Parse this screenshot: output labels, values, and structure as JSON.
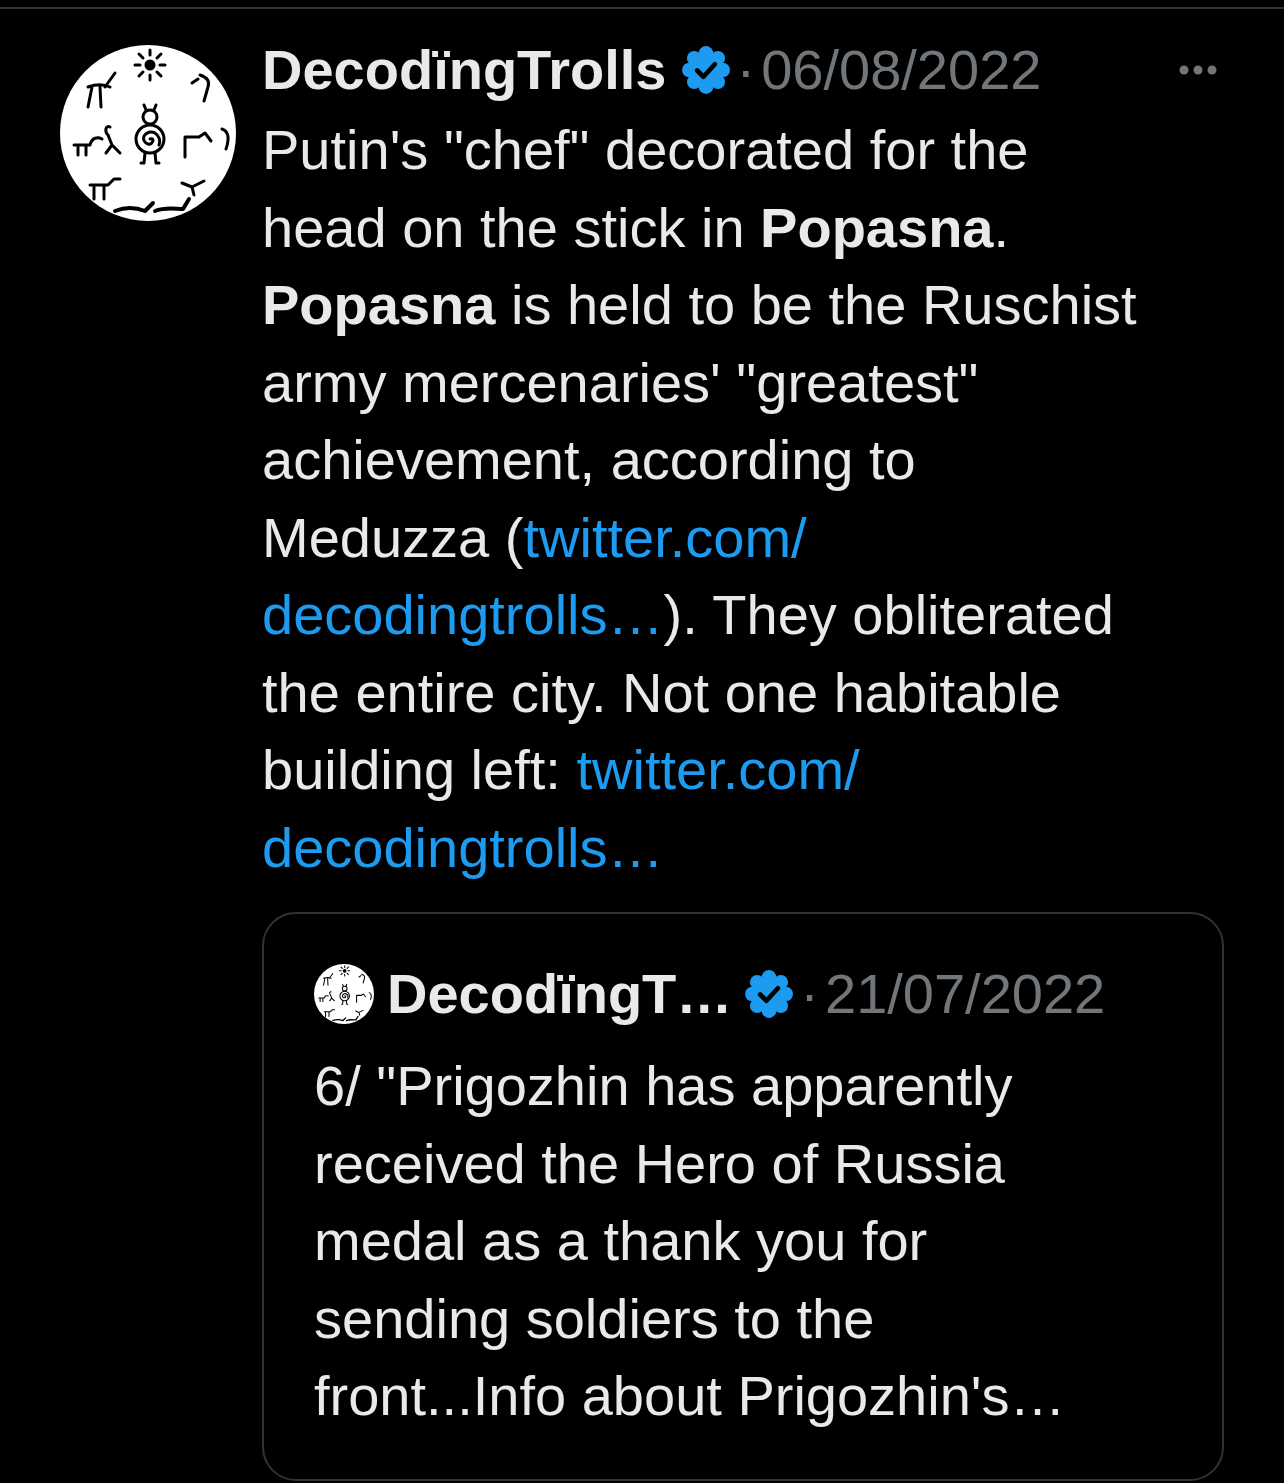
{
  "tweet": {
    "author": {
      "name": "DecodïngTrolls",
      "verified": true
    },
    "separator": "·",
    "date": "06/08/2022",
    "text": [
      {
        "kind": "text",
        "text": "Putin's \"chef\" decorated for the head on the stick in "
      },
      {
        "kind": "bold",
        "text": "Popasna"
      },
      {
        "kind": "text",
        "text": ". "
      },
      {
        "kind": "bold",
        "text": "Popasna"
      },
      {
        "kind": "text",
        "text": " is held to be the Ruschist army mercenaries' \"greatest\" achievement, according to Meduzza ("
      },
      {
        "kind": "link",
        "text": "twitter.com/"
      },
      {
        "kind": "link",
        "text": "decodingtrolls…"
      },
      {
        "kind": "text",
        "text": "). They obliterated the entire city. Not one habitable building left: "
      },
      {
        "kind": "link",
        "text": "twitter.com/"
      },
      {
        "kind": "link",
        "text": "decodingtrolls…"
      }
    ],
    "quote": {
      "author": {
        "name": "DecodïngT…",
        "verified": true
      },
      "separator": "·",
      "date": "21/07/2022",
      "text": "6/ \"Prigozhin has apparently received the Hero of Russia medal as a thank you for sending soldiers to the front...Info about Prigozhin's…"
    }
  }
}
